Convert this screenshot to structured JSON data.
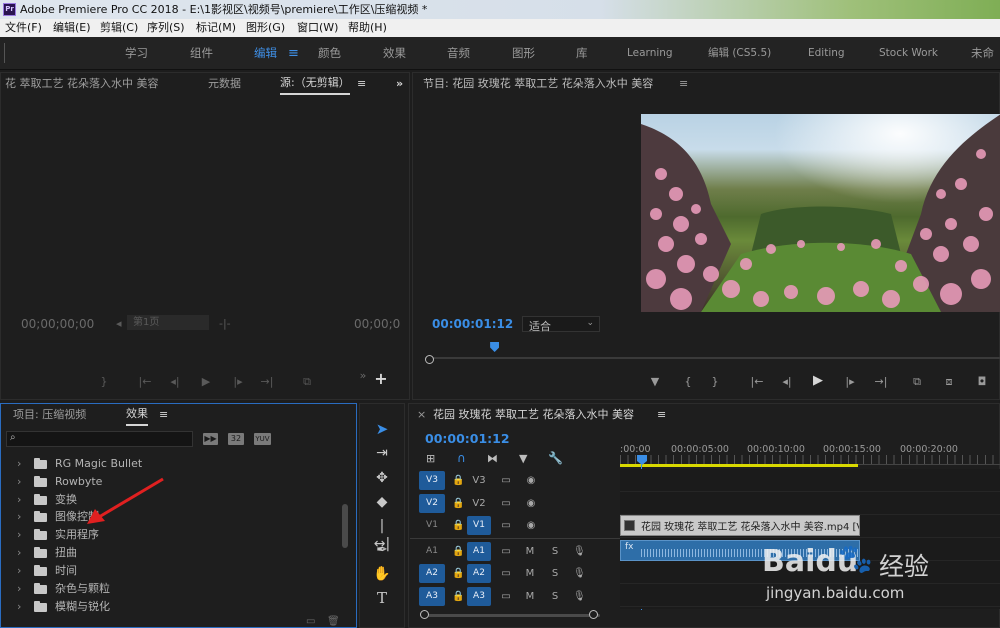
{
  "titlebar": {
    "app_icon": "Pr",
    "title": "Adobe Premiere Pro CC 2018 - E:\\1影视区\\视频号\\premiere\\工作区\\压缩视频 *"
  },
  "menu": {
    "items": [
      "文件(F)",
      "编辑(E)",
      "剪辑(C)",
      "序列(S)",
      "标记(M)",
      "图形(G)",
      "窗口(W)",
      "帮助(H)"
    ]
  },
  "workspaces": {
    "items": [
      "学习",
      "组件",
      "编辑",
      "颜色",
      "效果",
      "音频",
      "图形",
      "库",
      "Learning",
      "编辑 (CS5.5)",
      "Editing",
      "Stock Work",
      "未命"
    ],
    "active": "编辑",
    "active_menu_icon": "≡"
  },
  "source_panel": {
    "tab_left": "花 萃取工艺 花朵落入水中 美容",
    "tab_meta": "元数据",
    "tab_source": "源:（无剪辑）",
    "menu_icon": "≡",
    "overflow_icon": "»",
    "timecode_left": "00;00;00;00",
    "page_label": "第1页",
    "timecode_right": "00;00;0",
    "add_icon": "+"
  },
  "program_panel": {
    "title": "节目: 花园 玫瑰花 萃取工艺 花朵落入水中 美容",
    "menu_icon": "≡",
    "timecode": "00:00:01:12",
    "fit_label": "适合",
    "playhead_fraction": 0.12
  },
  "project_panel": {
    "tab_project": "项目: 压缩视频",
    "tab_effects": "效果",
    "menu_icon": "≡",
    "search_placeholder": "",
    "badge_32": "32",
    "badge_yuv": "YUV",
    "folders": [
      "RG Magic Bullet",
      "Rowbyte",
      "变换",
      "图像控制",
      "实用程序",
      "扭曲",
      "时间",
      "杂色与颗粒",
      "模糊与锐化"
    ]
  },
  "tools": [
    "selection-tool",
    "track-select-tool",
    "ripple-edit-tool",
    "razor-tool",
    "slip-tool",
    "pen-tool",
    "hand-tool",
    "type-tool"
  ],
  "timeline": {
    "close_icon": "×",
    "title": "花园 玫瑰花 萃取工艺 花朵落入水中 美容",
    "menu_icon": "≡",
    "timecode": "00:00:01:12",
    "ruler": [
      ":00:00",
      "00:00:05:00",
      "00:00:10:00",
      "00:00:15:00",
      "00:00:20:00"
    ],
    "tracks": [
      {
        "src": "",
        "name": "V3",
        "kind": "video"
      },
      {
        "src": "",
        "name": "V2",
        "kind": "video"
      },
      {
        "src": "V1",
        "name": "V1",
        "kind": "video"
      },
      {
        "src": "A1",
        "name": "A1",
        "kind": "audio"
      },
      {
        "src": "A2",
        "name": "A2",
        "kind": "audio"
      },
      {
        "src": "A3",
        "name": "A3",
        "kind": "audio"
      }
    ],
    "mute_label": "M",
    "solo_label": "S",
    "video_clip_label": "花园 玫瑰花 萃取工艺 花朵落入水中 美容.mp4 [V]",
    "audio_clip_label": "fx"
  },
  "watermark": {
    "brand": "Baidu",
    "brand_cn": "经验",
    "url": "jingyan.baidu.com"
  },
  "colors": {
    "accent": "#3a8ee6",
    "track_on": "#1f5b9a",
    "panel_bg": "#1e1e1e",
    "work_area": "#d8d800",
    "audio_clip": "#2e6ea8"
  }
}
